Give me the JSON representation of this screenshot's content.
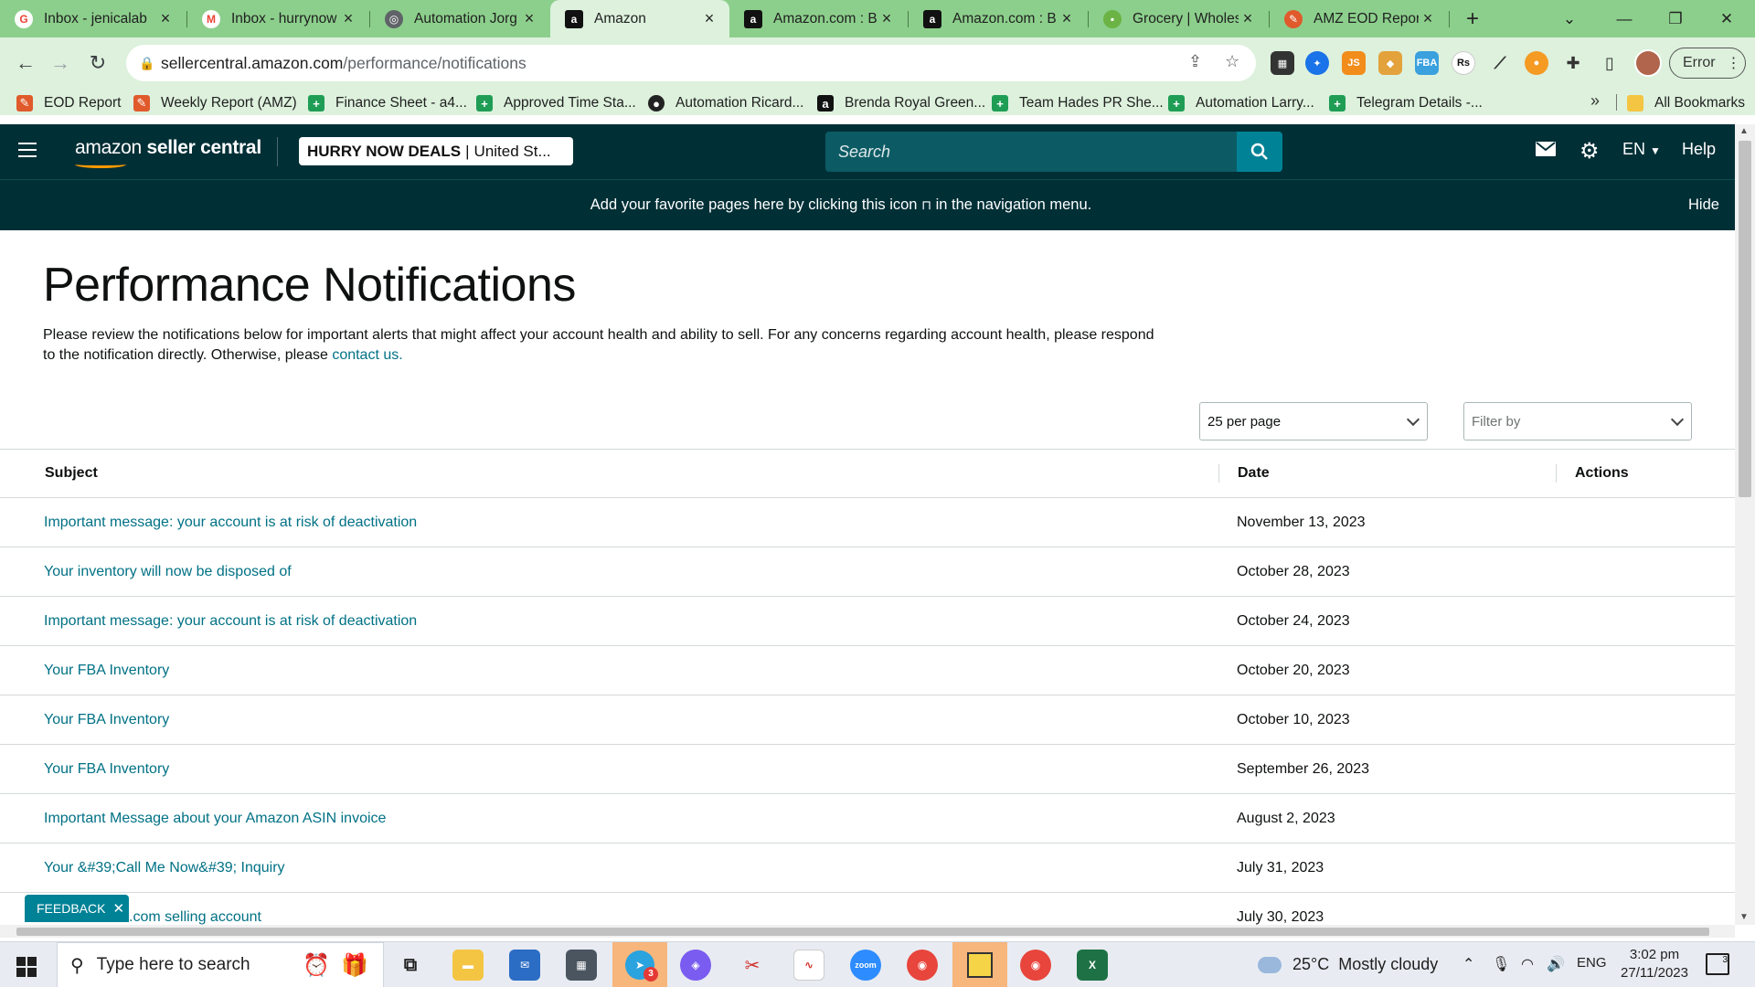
{
  "browser": {
    "tabs": [
      {
        "title": "Inbox - jenicalab",
        "icon": "gmail-icon",
        "color": "#ea4335",
        "active": false
      },
      {
        "title": "Inbox - hurrynow",
        "icon": "gmail-icon",
        "color": "#ea4335",
        "active": false
      },
      {
        "title": "Automation Jorg",
        "icon": "globe-icon",
        "color": "#5f6368",
        "active": false
      },
      {
        "title": "Amazon",
        "icon": "amazon-icon",
        "color": "#111111",
        "active": true
      },
      {
        "title": "Amazon.com : B",
        "icon": "amazon-icon",
        "color": "#111111",
        "active": false
      },
      {
        "title": "Amazon.com : B",
        "icon": "amazon-icon",
        "color": "#111111",
        "active": false
      },
      {
        "title": "Grocery | Wholes",
        "icon": "wholesale-icon",
        "color": "#6bb344",
        "active": false
      },
      {
        "title": "AMZ EOD Repor",
        "icon": "report-icon",
        "color": "#e05a2b",
        "active": false
      }
    ],
    "url_domain": "sellercentral.amazon.com",
    "url_path": "/performance/notifications",
    "error_label": "Error",
    "bookmarks": [
      {
        "label": "EOD Report",
        "icon": "report-icon"
      },
      {
        "label": "Weekly Report (AMZ)",
        "icon": "report-icon"
      },
      {
        "label": "Finance Sheet - a4...",
        "icon": "sheets-icon"
      },
      {
        "label": "Approved Time Sta...",
        "icon": "sheets-icon"
      },
      {
        "label": "Automation Ricard...",
        "icon": "github-icon"
      },
      {
        "label": "Brenda Royal Green...",
        "icon": "amazon-icon"
      },
      {
        "label": "Team Hades PR She...",
        "icon": "sheets-icon"
      },
      {
        "label": "Automation Larry...",
        "icon": "sheets-icon"
      },
      {
        "label": "Telegram Details -...",
        "icon": "sheets-icon"
      }
    ],
    "all_bookmarks_label": "All Bookmarks"
  },
  "seller_central": {
    "logo_light": "amazon",
    "logo_bold": "seller central",
    "store_name": "HURRY NOW DEALS",
    "store_region": "United St...",
    "search_placeholder": "Search",
    "lang": "EN",
    "help": "Help",
    "fav_message": "Add your favorite pages here by clicking this icon",
    "fav_message_end": "in the navigation menu.",
    "hide": "Hide"
  },
  "page": {
    "title": "Performance Notifications",
    "description": "Please review the notifications below for important alerts that might affect your account health and ability to sell. For any concerns regarding account health, please respond to the notification directly. Otherwise, please",
    "contact_link": "contact us.",
    "per_page": "25 per page",
    "filter_placeholder": "Filter by",
    "columns": {
      "subject": "Subject",
      "date": "Date",
      "actions": "Actions"
    },
    "rows": [
      {
        "subject": "Important message: your account is at risk of deactivation",
        "date": "November 13, 2023"
      },
      {
        "subject": "Your inventory will now be disposed of",
        "date": "October 28, 2023"
      },
      {
        "subject": "Important message: your account is at risk of deactivation",
        "date": "October 24, 2023"
      },
      {
        "subject": "Your FBA Inventory",
        "date": "October 20, 2023"
      },
      {
        "subject": "Your FBA Inventory",
        "date": "October 10, 2023"
      },
      {
        "subject": "Your FBA Inventory",
        "date": "September 26, 2023"
      },
      {
        "subject": "Important Message about your Amazon ASIN invoice",
        "date": "August 2, 2023"
      },
      {
        "subject": "Your &#39;Call Me Now&#39; Inquiry",
        "date": "July 31, 2023"
      },
      {
        "subject": ".com selling account",
        "date": "July 30, 2023"
      }
    ],
    "feedback": "FEEDBACK"
  },
  "taskbar": {
    "search_placeholder": "Type here to search",
    "temperature": "25°C",
    "weather": "Mostly cloudy",
    "language": "ENG",
    "time": "3:02 pm",
    "date": "27/11/2023",
    "notifications": "3",
    "telegram_badge": "3"
  }
}
